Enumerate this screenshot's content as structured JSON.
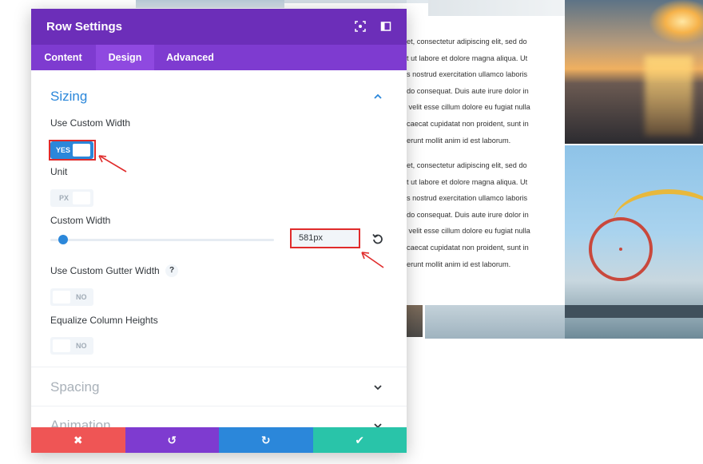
{
  "background_page": {
    "text_block_1": [
      "et, consectetur adipiscing elit, sed do",
      "t ut labore et dolore magna aliqua. Ut",
      "s nostrud exercitation ullamco laboris",
      "do consequat. Duis aute irure dolor in",
      " velit esse cillum dolore eu fugiat nulla",
      "caecat cupidatat non proident, sunt in",
      "erunt mollit anim id est laborum."
    ],
    "text_block_2": [
      "et, consectetur adipiscing elit, sed do",
      "t ut labore et dolore magna aliqua. Ut",
      "s nostrud exercitation ullamco laboris",
      "do consequat. Duis aute irure dolor in",
      " velit esse cillum dolore eu fugiat nulla",
      "caecat cupidatat non proident, sunt in",
      "erunt mollit anim id est laborum."
    ]
  },
  "modal": {
    "title": "Row Settings",
    "header_icons": [
      "focus-icon",
      "sidebar-toggle-icon"
    ],
    "tabs": [
      {
        "label": "Content",
        "active": false
      },
      {
        "label": "Design",
        "active": true
      },
      {
        "label": "Advanced",
        "active": false
      }
    ],
    "sections": {
      "sizing": {
        "title": "Sizing",
        "expanded": true
      },
      "spacing": {
        "title": "Spacing",
        "expanded": false
      },
      "animation": {
        "title": "Animation",
        "expanded": false
      }
    },
    "fields": {
      "use_custom_width": {
        "label": "Use Custom Width",
        "value": "YES",
        "on": true
      },
      "unit": {
        "label": "Unit",
        "value": "PX"
      },
      "custom_width": {
        "label": "Custom Width",
        "value": "581px",
        "slider_fraction": 0.06
      },
      "use_custom_gutter": {
        "label": "Use Custom Gutter Width",
        "help": "?",
        "value": "NO",
        "on": false
      },
      "equalize_heights": {
        "label": "Equalize Column Heights",
        "value": "NO",
        "on": false
      }
    },
    "footer": {
      "cancel": {
        "icon": "✖",
        "color": "#ef5555"
      },
      "undo": {
        "icon": "↺",
        "color": "#7e3bd0"
      },
      "redo": {
        "icon": "↻",
        "color": "#2b87da"
      },
      "save": {
        "icon": "✔",
        "color": "#29c4a9"
      }
    }
  },
  "colors": {
    "header": "#6c2eb9",
    "tabs": "#7e3bd0",
    "accent": "#2b87da",
    "annotation": "#e02b2b"
  }
}
